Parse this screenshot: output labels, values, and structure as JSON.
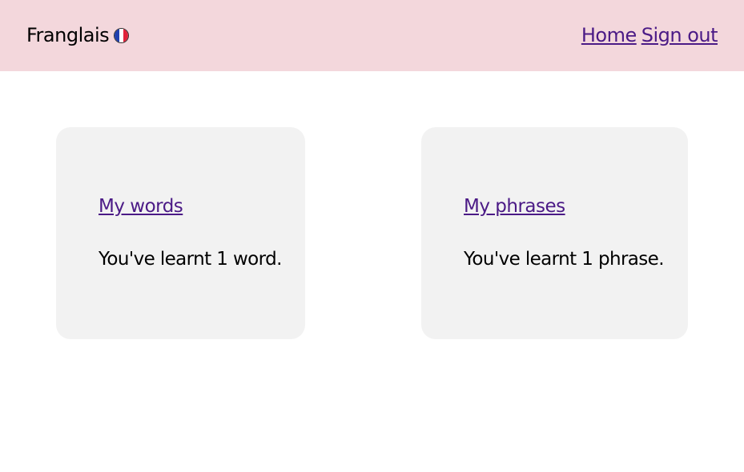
{
  "header": {
    "brand": "Franglais",
    "flag_icon": "french-flag-icon",
    "flag_colors": [
      "#1f3fae",
      "#ffffff",
      "#e0223a"
    ],
    "background": "#f3d7dc",
    "nav": {
      "home_label": "Home",
      "signout_label": "Sign out"
    }
  },
  "cards": {
    "words": {
      "link_label": "My words",
      "summary": "You've learnt 1 word."
    },
    "phrases": {
      "link_label": "My phrases",
      "summary": "You've learnt 1 phrase."
    }
  },
  "colors": {
    "link": "#4b1a86",
    "card_bg": "#f2f2f2"
  }
}
